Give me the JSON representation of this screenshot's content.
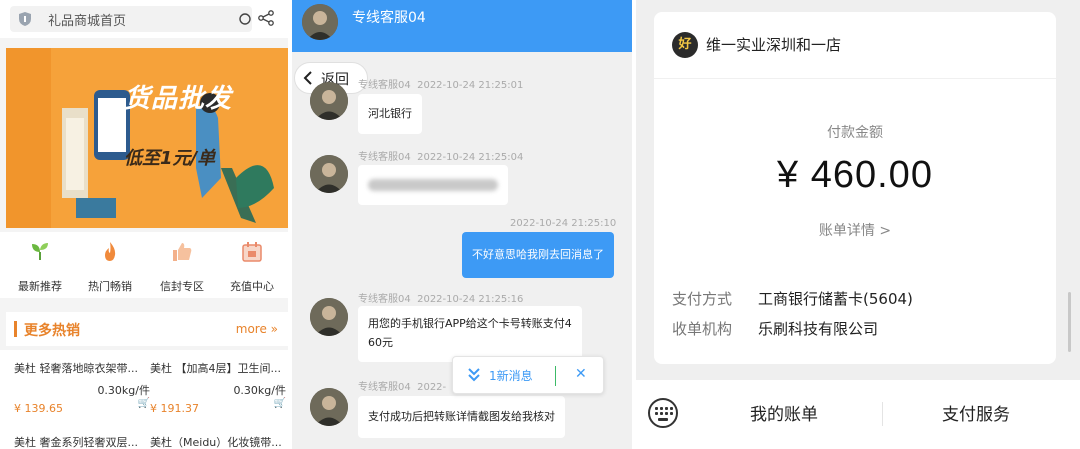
{
  "shop": {
    "search_text": "礼品商城首页",
    "banner_title": "货品批发",
    "banner_sub": "低至1元/单",
    "nav": [
      {
        "label": "最新推荐",
        "icon": "sprout-icon"
      },
      {
        "label": "热门畅销",
        "icon": "flame-icon"
      },
      {
        "label": "信封专区",
        "icon": "thumbs-up-icon"
      },
      {
        "label": "充值中心",
        "icon": "calendar-icon"
      }
    ],
    "section_title": "更多热销",
    "more_link": "more »",
    "products": [
      {
        "name": "美杜 轻奢落地晾衣架带...",
        "weight": "0.30kg/件",
        "price": "¥ 139.65"
      },
      {
        "name": "美杜 【加高4层】卫生间...",
        "weight": "0.30kg/件",
        "price": "¥ 191.37"
      }
    ],
    "next_products": [
      "美杜 奢金系列轻奢双层...",
      "美杜（Meidu）化妆镜带..."
    ]
  },
  "chat": {
    "title": "专线客服04",
    "back_label": "返回",
    "messages": [
      {
        "sender": "专线客服04",
        "time": "2022-10-24 21:25:01",
        "text": "河北银行"
      },
      {
        "sender": "专线客服04",
        "time": "2022-10-24 21:25:04",
        "text": ""
      },
      {
        "sender": "",
        "time": "2022-10-24 21:25:10",
        "text": "不好意思哈我刚去回消息了"
      },
      {
        "sender": "专线客服04",
        "time": "2022-10-24 21:25:16",
        "text_line1": "用您的手机银行APP给这个卡号转账支付4",
        "text_line2": "60元"
      },
      {
        "sender": "专线客服04",
        "time": "2022-",
        "text": "支付成功后把转账详情截图发给我核对"
      }
    ],
    "new_msg_label": "1新消息",
    "new_msg_close": "✕"
  },
  "payment": {
    "logo_text": "好",
    "merchant": "维一实业深圳和一店",
    "amount_label": "付款金额",
    "amount": "¥ 460.00",
    "bill_detail": "账单详情 >",
    "method_label": "支付方式",
    "method_value": "工商银行储蓄卡(5604)",
    "agency_label": "收单机构",
    "agency_value": "乐刷科技有限公司",
    "bottom_left": "我的账单",
    "bottom_right": "支付服务"
  }
}
